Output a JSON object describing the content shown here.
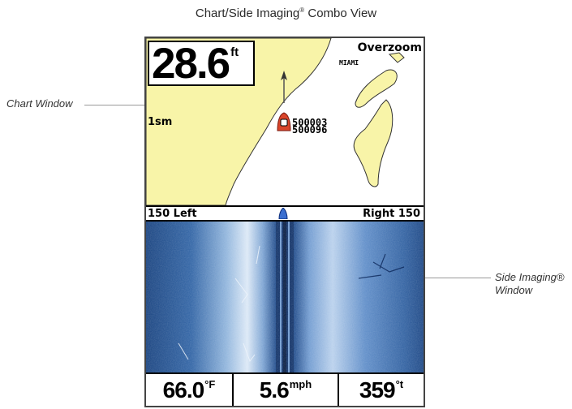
{
  "page": {
    "title": "Chart/Side Imaging",
    "title_mark": "®",
    "title_suffix": " Combo View"
  },
  "callouts": {
    "chart_window": "Chart Window",
    "side_imaging_line1": "Side Imaging®",
    "side_imaging_line2": "Window"
  },
  "chart": {
    "depth_value": "28.6",
    "depth_unit": "ft",
    "overzoom": "Overzoom",
    "place_label": "MIAMI",
    "scale": "1sm",
    "waypoint_line1": "500003",
    "waypoint_line2": "500096",
    "colors": {
      "land": "#f8f4a8",
      "water": "#ffffff",
      "boat": "#d9452b"
    }
  },
  "range_bar": {
    "left": "150 Left",
    "right": "Right 150"
  },
  "readouts": [
    {
      "value": "66.0",
      "unit": "°F"
    },
    {
      "value": "5.6",
      "unit": "mph"
    },
    {
      "value": "359",
      "unit": "°t"
    }
  ],
  "icons": [
    "boat-cursor-icon",
    "heading-arrow-icon",
    "waypoint-icon",
    "boat-marker-icon",
    "arrow-icon"
  ]
}
